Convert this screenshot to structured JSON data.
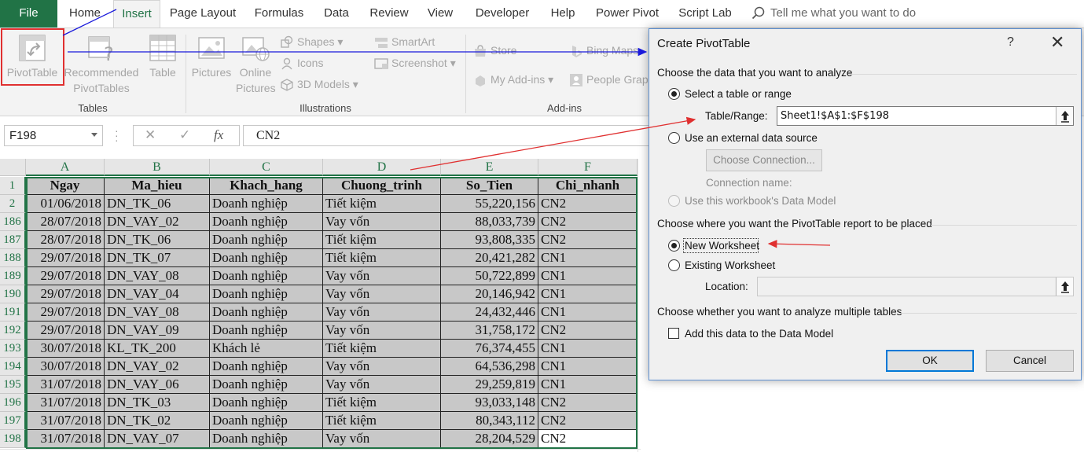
{
  "tabs": [
    "File",
    "Home",
    "Insert",
    "Page Layout",
    "Formulas",
    "Data",
    "Review",
    "View",
    "Developer",
    "Help",
    "Power Pivot",
    "Script Lab"
  ],
  "tell_me": "Tell me what you want to do",
  "ribbon": {
    "tables": {
      "pivot_table": "PivotTable",
      "recommended_1": "Recommended",
      "recommended_2": "PivotTables",
      "table": "Table",
      "group": "Tables"
    },
    "illustrations": {
      "pictures": "Pictures",
      "online_1": "Online",
      "online_2": "Pictures",
      "shapes": "Shapes",
      "icons": "Icons",
      "models_3d": "3D Models",
      "smartart": "SmartArt",
      "screenshot": "Screenshot",
      "group": "Illustrations"
    },
    "addins": {
      "store": "Store",
      "my_addins": "My Add-ins",
      "bing_maps": "Bing Maps",
      "people_graph": "People Graph",
      "group": "Add-ins"
    }
  },
  "formula_bar": {
    "name_box": "F198",
    "fx": "fx",
    "value": "CN2"
  },
  "sheet": {
    "columns": [
      "A",
      "B",
      "C",
      "D",
      "E",
      "F"
    ],
    "header_row": "1",
    "headers": [
      "Ngay",
      "Ma_hieu",
      "Khach_hang",
      "Chuong_trinh",
      "So_Tien",
      "Chi_nhanh"
    ],
    "rows": [
      {
        "n": "2",
        "cells": [
          "01/06/2018",
          "DN_TK_06",
          "Doanh nghiệp",
          "Tiết kiệm",
          "55,220,156",
          "CN2"
        ]
      },
      {
        "n": "186",
        "cells": [
          "28/07/2018",
          "DN_VAY_02",
          "Doanh nghiệp",
          "Vay vốn",
          "88,033,739",
          "CN2"
        ]
      },
      {
        "n": "187",
        "cells": [
          "28/07/2018",
          "DN_TK_06",
          "Doanh nghiệp",
          "Tiết kiệm",
          "93,808,335",
          "CN2"
        ]
      },
      {
        "n": "188",
        "cells": [
          "29/07/2018",
          "DN_TK_07",
          "Doanh nghiệp",
          "Tiết kiệm",
          "20,421,282",
          "CN1"
        ]
      },
      {
        "n": "189",
        "cells": [
          "29/07/2018",
          "DN_VAY_08",
          "Doanh nghiệp",
          "Vay vốn",
          "50,722,899",
          "CN1"
        ]
      },
      {
        "n": "190",
        "cells": [
          "29/07/2018",
          "DN_VAY_04",
          "Doanh nghiệp",
          "Vay vốn",
          "20,146,942",
          "CN1"
        ]
      },
      {
        "n": "191",
        "cells": [
          "29/07/2018",
          "DN_VAY_08",
          "Doanh nghiệp",
          "Vay vốn",
          "24,432,446",
          "CN1"
        ]
      },
      {
        "n": "192",
        "cells": [
          "29/07/2018",
          "DN_VAY_09",
          "Doanh nghiệp",
          "Vay vốn",
          "31,758,172",
          "CN2"
        ]
      },
      {
        "n": "193",
        "cells": [
          "30/07/2018",
          "KL_TK_200",
          "Khách lẻ",
          "Tiết kiệm",
          "76,374,455",
          "CN1"
        ]
      },
      {
        "n": "194",
        "cells": [
          "30/07/2018",
          "DN_VAY_02",
          "Doanh nghiệp",
          "Vay vốn",
          "64,536,298",
          "CN1"
        ]
      },
      {
        "n": "195",
        "cells": [
          "31/07/2018",
          "DN_VAY_06",
          "Doanh nghiệp",
          "Vay vốn",
          "29,259,819",
          "CN1"
        ]
      },
      {
        "n": "196",
        "cells": [
          "31/07/2018",
          "DN_TK_03",
          "Doanh nghiệp",
          "Tiết kiệm",
          "93,033,148",
          "CN2"
        ]
      },
      {
        "n": "197",
        "cells": [
          "31/07/2018",
          "DN_TK_02",
          "Doanh nghiệp",
          "Tiết kiệm",
          "80,343,112",
          "CN2"
        ]
      },
      {
        "n": "198",
        "cells": [
          "31/07/2018",
          "DN_VAY_07",
          "Doanh nghiệp",
          "Vay vốn",
          "28,204,529",
          "CN2"
        ]
      }
    ]
  },
  "dialog": {
    "title": "Create PivotTable",
    "help": "?",
    "close": "✕",
    "section_analyze": "Choose the data that you want to analyze",
    "opt_select_table": "Select a table or range",
    "table_range_label": "Table/Range:",
    "table_range_value": "Sheet1!$A$1:$F$198",
    "opt_external": "Use an external data source",
    "choose_connection": "Choose Connection...",
    "connection_name": "Connection name:",
    "opt_data_model": "Use this workbook's Data Model",
    "section_place": "Choose where you want the PivotTable report to be placed",
    "opt_new_ws": "New Worksheet",
    "opt_existing_ws": "Existing Worksheet",
    "location_label": "Location:",
    "location_value": "",
    "section_multi": "Choose whether you want to analyze multiple tables",
    "add_data_model": "Add this data to the Data Model",
    "ok": "OK",
    "cancel": "Cancel"
  },
  "colors": {
    "excel_green": "#217346",
    "annotation_red": "#e03030",
    "annotation_blue": "#1a1adb",
    "default_button_border": "#0078d7"
  }
}
